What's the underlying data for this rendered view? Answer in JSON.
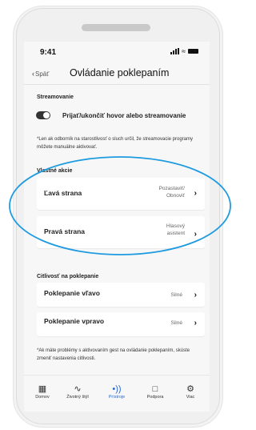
{
  "status": {
    "time": "9:41"
  },
  "nav": {
    "back_label": "Späť",
    "title": "Ovládanie poklepaním"
  },
  "streaming": {
    "section_label": "Streamovanie",
    "toggle_label": "Prijať/ukončiť hovor alebo streamovanie",
    "toggle_on": true,
    "note": "*Len ak odborník na starostlivosť o sluch určil, že streamovacie programy môžete manuálne aktivovať."
  },
  "custom_actions": {
    "section_label": "Vlastné akcie",
    "items": [
      {
        "label": "Ľavá strana",
        "value_line1": "Pozastaviť/",
        "value_line2": "Obnoviť"
      },
      {
        "label": "Pravá strana",
        "value_line1": "Hlasový",
        "value_line2": "asistent"
      }
    ]
  },
  "sensitivity": {
    "section_label": "Citlivosť na poklepanie",
    "items": [
      {
        "label": "Poklepanie vľavo",
        "value": "Silné"
      },
      {
        "label": "Poklepanie vpravo",
        "value": "Silné"
      }
    ],
    "note": "*Ak máte problémy s aktivovaním gest na ovládanie poklepaním, skúste zmeniť nastavenia citlivosti."
  },
  "tabs": [
    {
      "label": "Domov",
      "icon": "grid-icon",
      "active": false
    },
    {
      "label": "Životný štýl",
      "icon": "activity-icon",
      "active": false
    },
    {
      "label": "Prístroje",
      "icon": "hearing-aid-icon",
      "active": true
    },
    {
      "label": "Podpora",
      "icon": "chat-icon",
      "active": false
    },
    {
      "label": "Viac",
      "icon": "gear-icon",
      "active": false
    }
  ],
  "colors": {
    "accent": "#2a6ad3",
    "highlight": "#1e9be0",
    "toggle": "#333333"
  }
}
